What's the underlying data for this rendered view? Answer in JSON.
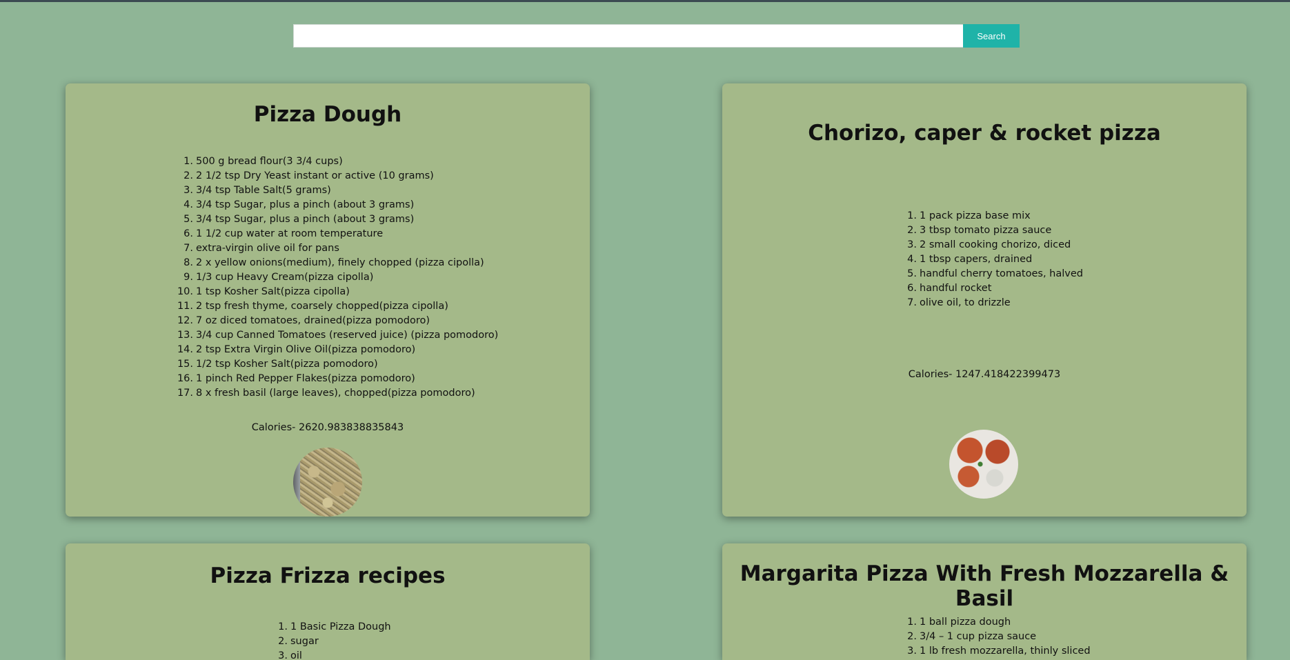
{
  "search": {
    "placeholder": "",
    "value": "",
    "button_label": "Search"
  },
  "recipes": [
    {
      "title": "Pizza Dough",
      "ingredients": [
        "500 g bread flour(3 3/4 cups)",
        "2 1/2 tsp Dry Yeast instant or active (10 grams)",
        "3/4 tsp Table Salt(5 grams)",
        "3/4 tsp Sugar, plus a pinch (about 3 grams)",
        "3/4 tsp Sugar, plus a pinch (about 3 grams)",
        "1 1/2 cup water at room temperature",
        "extra-virgin olive oil for pans",
        "2 x yellow onions(medium), finely chopped (pizza cipolla)",
        "1/3 cup Heavy Cream(pizza cipolla)",
        "1 tsp Kosher Salt(pizza cipolla)",
        "2 tsp fresh thyme, coarsely chopped(pizza cipolla)",
        "7 oz diced tomatoes, drained(pizza pomodoro)",
        "3/4 cup Canned Tomatoes (reserved juice) (pizza pomodoro)",
        "2 tsp Extra Virgin Olive Oil(pizza pomodoro)",
        "1/2 tsp Kosher Salt(pizza pomodoro)",
        "1 pinch Red Pepper Flakes(pizza pomodoro)",
        "8 x fresh basil (large leaves), chopped(pizza pomodoro)"
      ],
      "calories": "Calories- 2620.983838835843",
      "image_icon": "pizza-dough-photo"
    },
    {
      "title": "Chorizo, caper & rocket pizza",
      "ingredients": [
        "1 pack pizza base mix",
        "3 tbsp tomato pizza sauce",
        "2 small cooking chorizo, diced",
        "1 tbsp capers, drained",
        "handful cherry tomatoes, halved",
        "handful rocket",
        "olive oil, to drizzle"
      ],
      "calories": "Calories- 1247.418422399473",
      "image_icon": "chorizo-pizza-photo"
    },
    {
      "title": "Pizza Frizza recipes",
      "ingredients": [
        "1 Basic Pizza Dough",
        "sugar",
        "oil"
      ]
    },
    {
      "title": "Margarita Pizza With Fresh Mozzarella & Basil",
      "ingredients": [
        "1 ball pizza dough",
        "3/4 – 1 cup pizza sauce",
        "1 lb fresh mozzarella, thinly sliced"
      ]
    }
  ]
}
